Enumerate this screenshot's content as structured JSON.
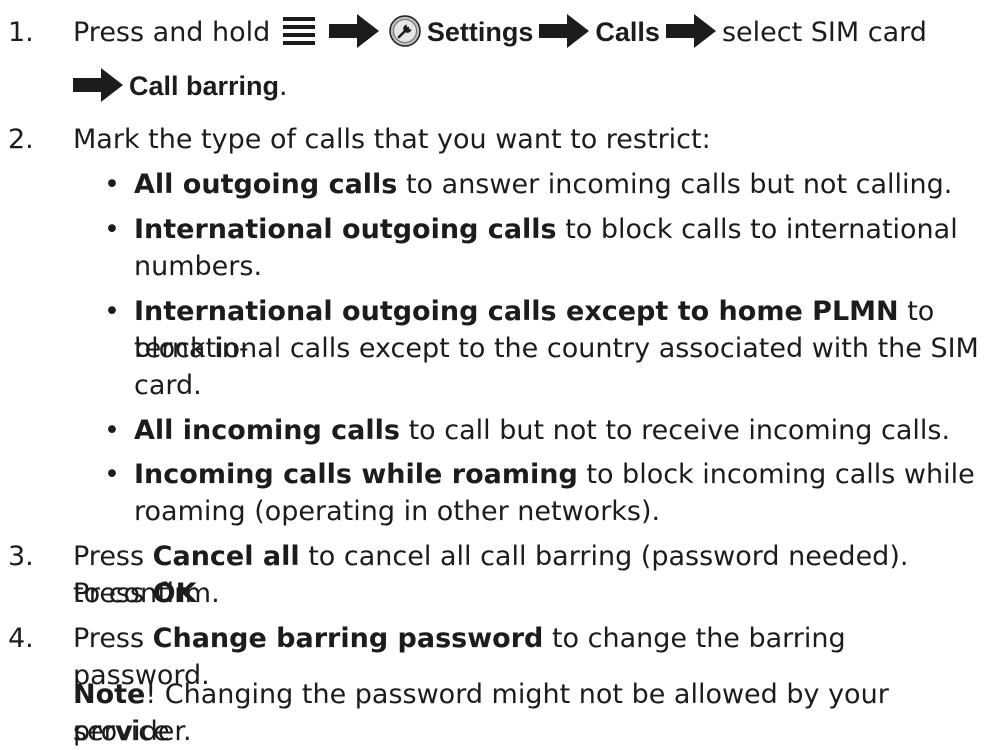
{
  "steps": [
    {
      "number": "1.",
      "pre": "Press and hold",
      "icons": {
        "menu": "menu-icon",
        "arrow": "arrow-right-icon",
        "settings": "settings-icon"
      },
      "settings_label": "Settings",
      "calls_label": "Calls",
      "select_text": "select SIM card",
      "call_barring_label": "Call barring",
      "end": "."
    },
    {
      "number": "2.",
      "text": "Mark the type of calls that you want to restrict:",
      "bullets": [
        {
          "bold": "All outgoing calls",
          "rest": " to answer incoming calls but not calling."
        },
        {
          "bold": "International outgoing calls",
          "rest": " to block calls to international",
          "rest2": "numbers."
        },
        {
          "bold": "International outgoing calls except to home PLMN",
          "rest": " to block in-",
          "rest2": "ternational calls except to the country associated with the SIM",
          "rest3": "card."
        },
        {
          "bold": "All incoming calls",
          "rest": " to call but not to receive incoming calls."
        },
        {
          "bold": "Incoming calls while roaming",
          "rest": " to block incoming calls while",
          "rest2": "roaming (operating in other networks)."
        }
      ],
      "bullet_char": "•"
    },
    {
      "number": "3.",
      "pre": "Press ",
      "bold1": "Cancel all",
      "mid": " to cancel all call barring (password needed). Press ",
      "bold2": "OK",
      "line2": "to confirm."
    },
    {
      "number": "4.",
      "pre": "Press ",
      "bold1": "Change barring password",
      "rest": " to change the barring password."
    }
  ],
  "note": {
    "label": "Note",
    "excl": "!",
    "text": " Changing the password might not be allowed by your service",
    "line2": "provider."
  },
  "colors": {
    "text": "#1c1c1c",
    "icon_grey": "#bdbdbd"
  }
}
